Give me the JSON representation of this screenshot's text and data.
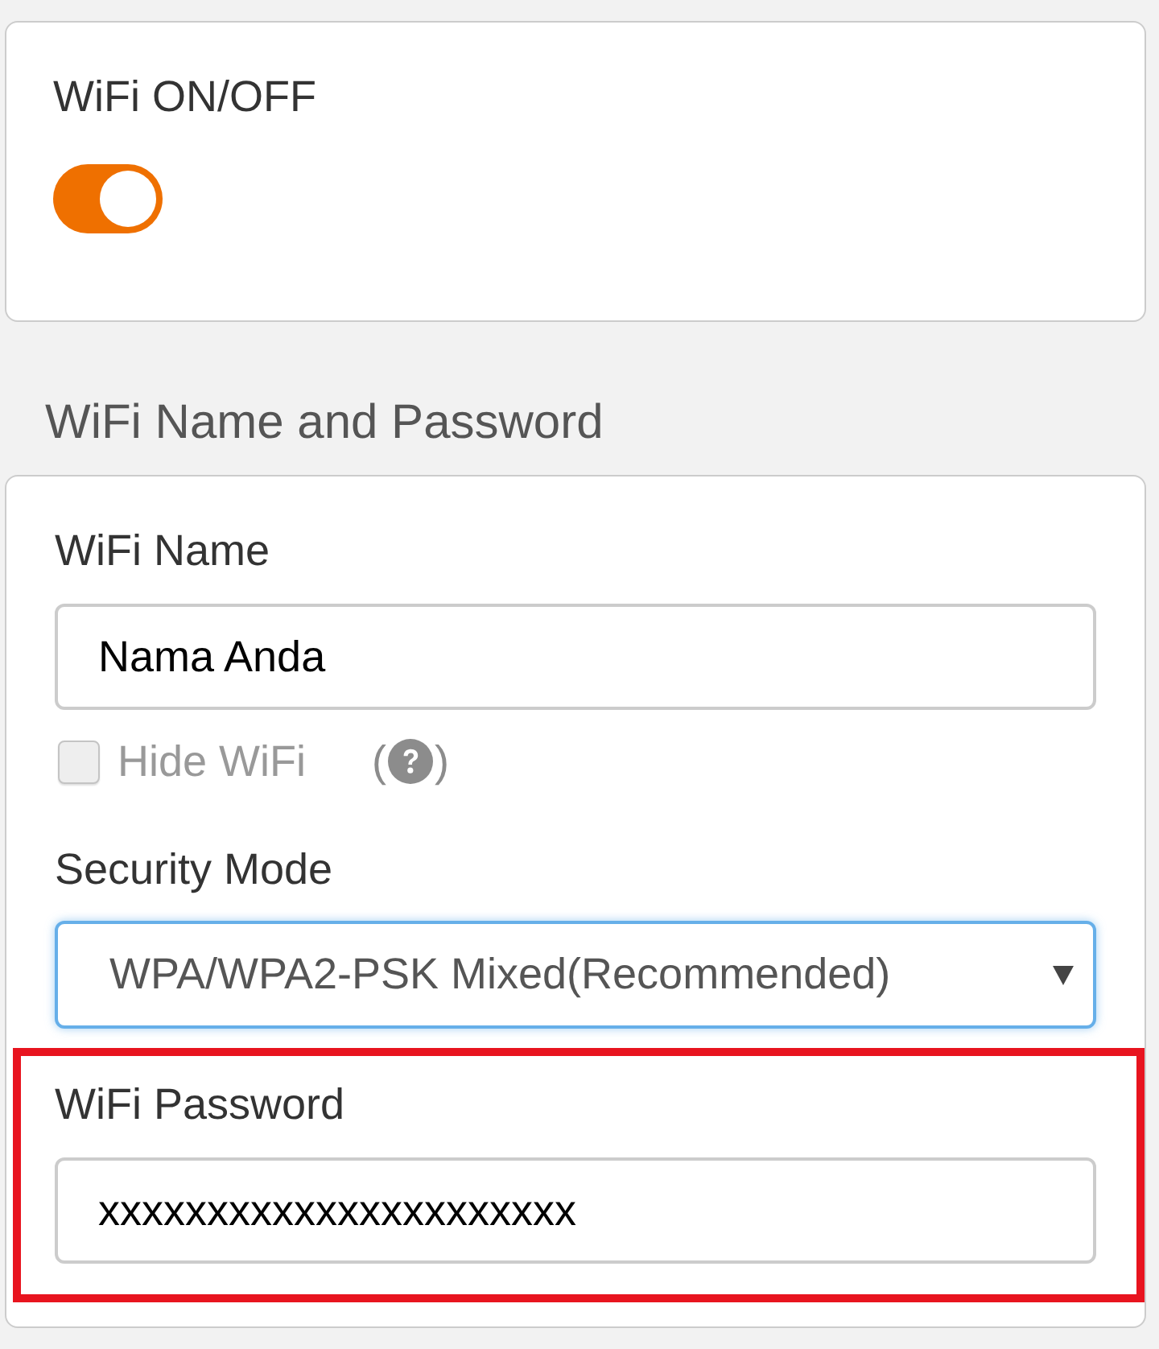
{
  "wifi_toggle": {
    "label": "WiFi ON/OFF",
    "on": true
  },
  "name_and_password": {
    "title": "WiFi Name and Password",
    "wifi_name": {
      "label": "WiFi Name",
      "value": "Nama Anda"
    },
    "hide_wifi": {
      "label": "Hide WiFi",
      "checked": false,
      "disabled": true,
      "help": {
        "before": "(",
        "after": ")"
      }
    },
    "security_mode": {
      "label": "Security Mode",
      "value": "WPA/WPA2-PSK Mixed(Recommended)",
      "focused": true
    },
    "wifi_password": {
      "label": "WiFi Password",
      "value": "xxxxxxxxxxxxxxxxxxxxxx",
      "highlighted": true
    }
  }
}
